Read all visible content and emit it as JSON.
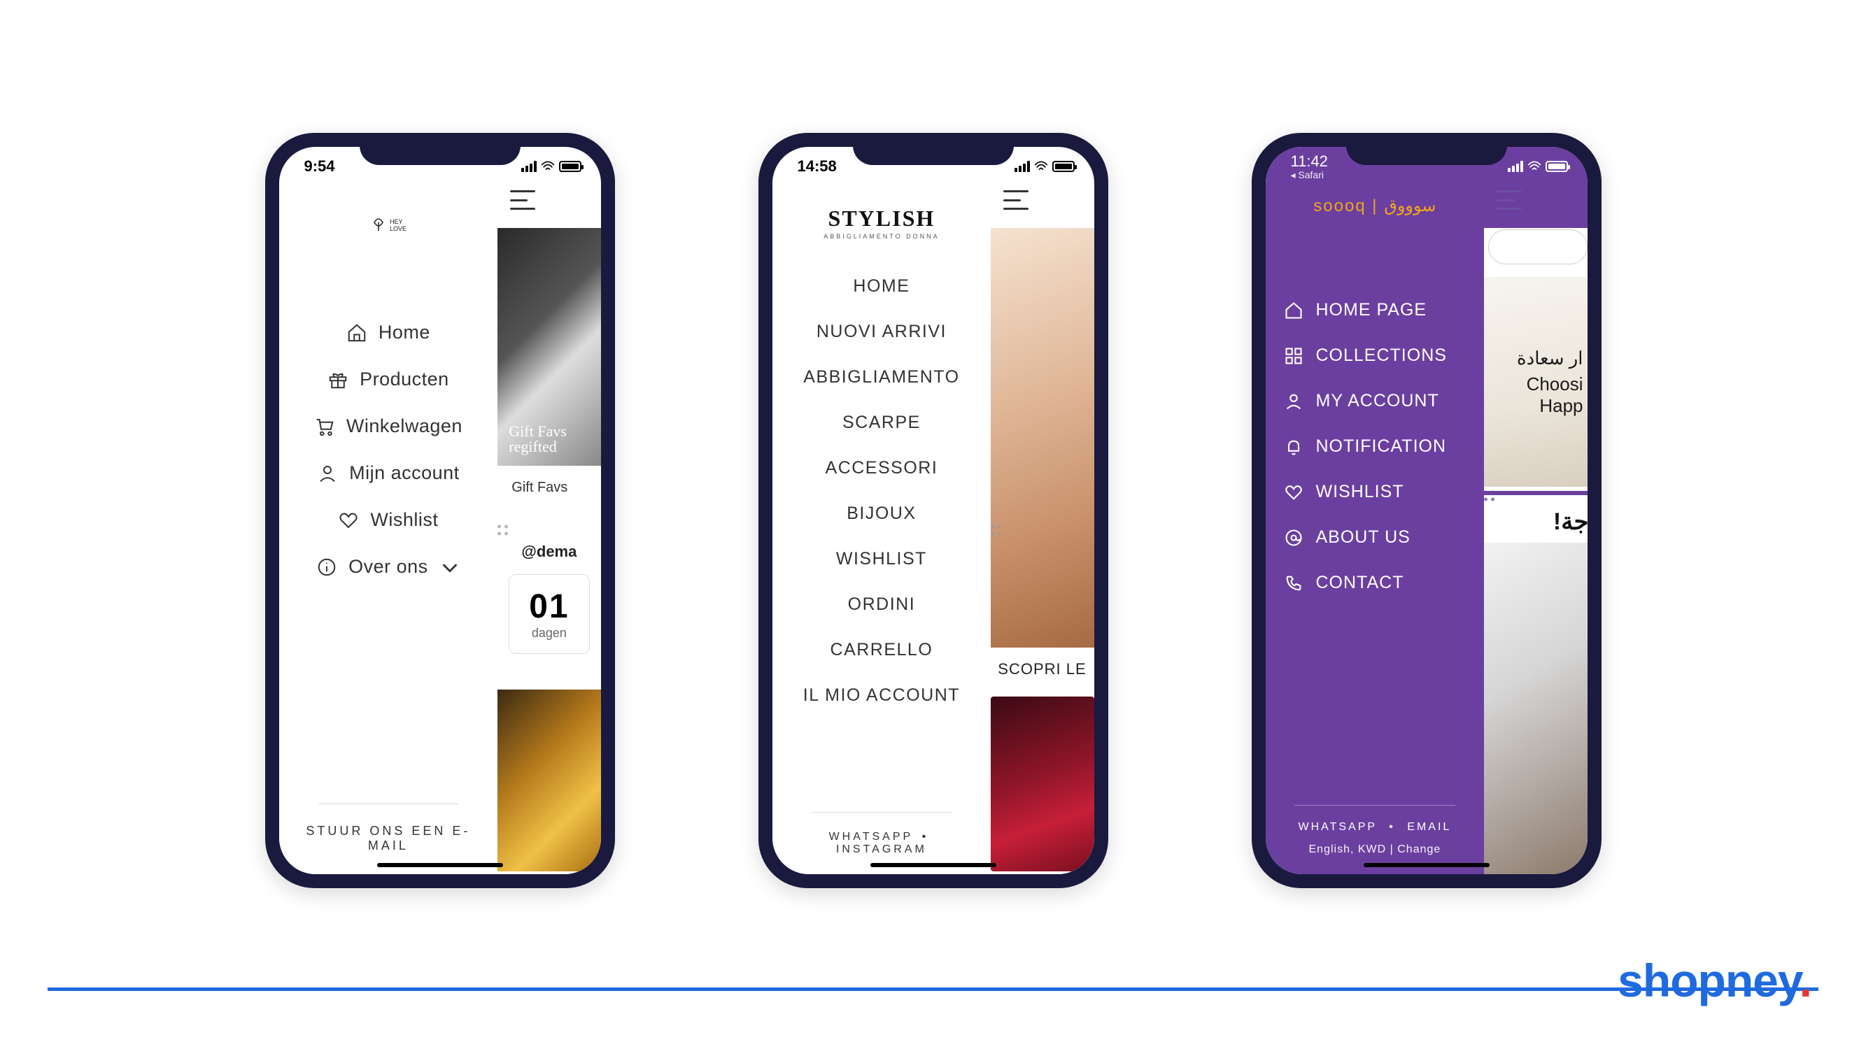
{
  "footer_brand": "shopney",
  "phones": {
    "p1": {
      "status": {
        "time": "9:54"
      },
      "menu": {
        "home": "Home",
        "products": "Producten",
        "cart": "Winkelwagen",
        "account": "Mijn account",
        "wishlist": "Wishlist",
        "about": "Over ons"
      },
      "footer": "STUUR ONS EEN E-MAIL",
      "peek": {
        "hero_script": "Gift Favs regifted",
        "caption": "Gift Favs",
        "handle": "@dema",
        "counter_num": "01",
        "counter_label": "dagen"
      }
    },
    "p2": {
      "status": {
        "time": "14:58"
      },
      "brand": "STYLISH",
      "brand_tag": "ABBIGLIAMENTO DONNA",
      "menu": {
        "home": "HOME",
        "new": "NUOVI ARRIVI",
        "clothing": "ABBIGLIAMENTO",
        "shoes": "SCARPE",
        "accessories": "ACCESSORI",
        "jewelry": "BIJOUX",
        "wishlist": "WISHLIST",
        "orders": "ORDINI",
        "cart": "CARRELLO",
        "account": "IL MIO ACCOUNT"
      },
      "footer": {
        "a": "WHATSAPP",
        "b": "INSTAGRAM"
      },
      "peek": {
        "cta": "SCOPRI LE"
      }
    },
    "p3": {
      "status": {
        "time": "11:42",
        "back": "Safari"
      },
      "brand": "soooq | سوووق",
      "menu": {
        "home": "HOME PAGE",
        "collections": "COLLECTIONS",
        "account": "MY ACCOUNT",
        "notification": "NOTIFICATION",
        "wishlist": "WISHLIST",
        "about": "ABOUT US",
        "contact": "CONTACT"
      },
      "footer": {
        "a": "WHATSAPP",
        "b": "EMAIL",
        "locale": "English, KWD | Change"
      },
      "peek": {
        "ar1": "ار سعادة",
        "en1": "Choosi",
        "en2": "Happ",
        "ar2": "!جة"
      }
    }
  }
}
